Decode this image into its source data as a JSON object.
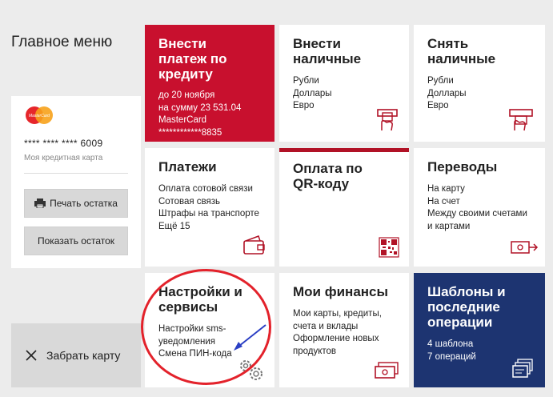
{
  "menu_title": "Главное меню",
  "card": {
    "number": "**** **** **** 6009",
    "label": "Моя кредитная карта",
    "logo_text": "MasterCard",
    "print_button": "Печать остатка",
    "show_button": "Показать остаток"
  },
  "eject_button": "Забрать карту",
  "tiles": {
    "credit_payment": {
      "title_lines": [
        "Внести",
        "платеж по",
        "кредиту"
      ],
      "lines": [
        "до 20 ноября",
        "на сумму 23 531.04",
        "MasterCard",
        "************8835"
      ]
    },
    "deposit_cash": {
      "title_lines": [
        "Внести",
        "наличные"
      ],
      "lines": [
        "Рубли",
        "Доллары",
        "Евро"
      ],
      "icon": "atm-deposit-icon"
    },
    "withdraw_cash": {
      "title_lines": [
        "Снять",
        "наличные"
      ],
      "lines": [
        "Рубли",
        "Доллары",
        "Евро"
      ],
      "icon": "atm-withdraw-icon"
    },
    "payments": {
      "title_lines": [
        "Платежи"
      ],
      "lines": [
        "Оплата сотовой связи",
        "Сотовая связь",
        "Штрафы на транспорте",
        "Ещё 15"
      ],
      "icon": "wallet-icon"
    },
    "qr_payment": {
      "title_lines": [
        "Оплата по",
        "QR-коду"
      ],
      "icon": "qr-code-icon"
    },
    "transfers": {
      "title_lines": [
        "Переводы"
      ],
      "lines": [
        "На карту",
        "На счет",
        "Между своими счетами",
        "и картами"
      ],
      "icon": "money-transfer-icon"
    },
    "settings": {
      "title_lines": [
        "Настройки и",
        "сервисы"
      ],
      "lines": [
        "Настройки sms-",
        "уведомления",
        "Смена ПИН-кода"
      ],
      "icon": "gears-icon"
    },
    "finances": {
      "title_lines": [
        "Мои финансы"
      ],
      "lines": [
        "Мои карты, кредиты,",
        "счета и вклады",
        "Оформление новых",
        "продуктов"
      ],
      "icon": "banknote-icon"
    },
    "templates": {
      "title_lines": [
        "Шаблоны и",
        "последние",
        "операции"
      ],
      "lines": [
        "4 шаблона",
        "7 операций"
      ],
      "icon": "templates-icon"
    }
  },
  "colors": {
    "accent_red": "#c8102e",
    "navy": "#1d3471",
    "icon_red": "#b11226",
    "annotation_red": "#e3222b",
    "annotation_blue": "#2b3fc4"
  }
}
